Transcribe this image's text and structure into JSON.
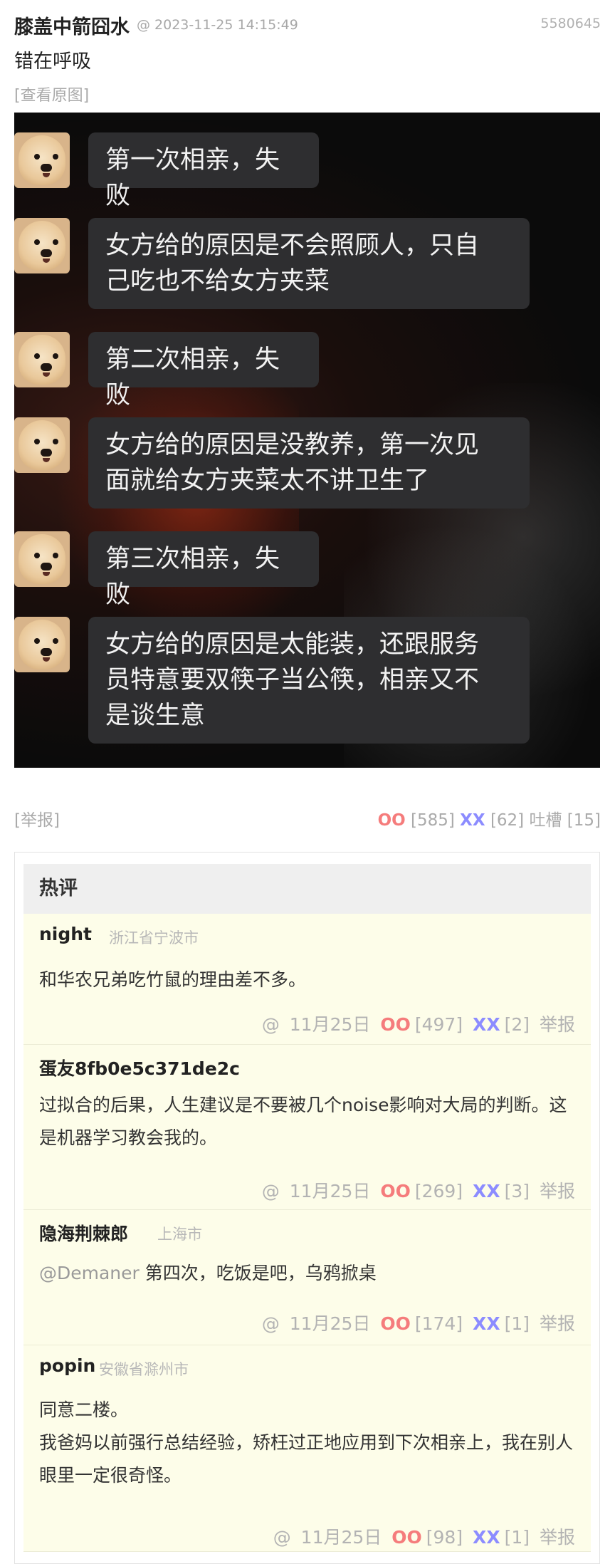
{
  "post": {
    "author": "膝盖中箭囧水",
    "time": "@ 2023-11-25 14:15:49",
    "id": "5580645",
    "text": "错在呼吸",
    "view_original": "[查看原图]"
  },
  "chat_image": {
    "messages": [
      "第一次相亲，失败",
      "女方给的原因是不会照顾人，只自\n己吃也不给女方夹菜",
      "第二次相亲，失败",
      "女方给的原因是没教养，第一次见\n面就给女方夹菜太不讲卫生了",
      "第三次相亲，失败",
      "女方给的原因是太能装，还跟服务\n员特意要双筷子当公筷，相亲又不\n是谈生意"
    ]
  },
  "post_footer": {
    "report": "[举报]",
    "oo_label": "OO",
    "oo_count": "[585]",
    "xx_label": "XX",
    "xx_count": "[62]",
    "tucao_label": "吐槽",
    "tucao_count": "[15]"
  },
  "hot_comments": {
    "title": "热评",
    "items": [
      {
        "name": "night",
        "location": "浙江省宁波市",
        "mention": "",
        "text": "和华农兄弟吃竹鼠的理由差不多。",
        "at": "@",
        "date": "11月25日",
        "oo_label": "OO",
        "oo": "[497]",
        "xx_label": "XX",
        "xx": "[2]",
        "report": "举报"
      },
      {
        "name": "蛋友8fb0e5c371de2c",
        "location": "",
        "mention": "",
        "text": "过拟合的后果，人生建议是不要被几个noise影响对大局的判断。这是机器学习教会我的。",
        "at": "@",
        "date": "11月25日",
        "oo_label": "OO",
        "oo": "[269]",
        "xx_label": "XX",
        "xx": "[3]",
        "report": "举报"
      },
      {
        "name": "隐海荆棘郎",
        "location": "上海市",
        "mention": "@Demaner",
        "text": " 第四次，吃饭是吧，乌鸦掀桌",
        "at": "@",
        "date": "11月25日",
        "oo_label": "OO",
        "oo": "[174]",
        "xx_label": "XX",
        "xx": "[1]",
        "report": "举报"
      },
      {
        "name": "popin",
        "location": "安徽省滁州市",
        "mention": "",
        "text": "同意二楼。\n我爸妈以前强行总结经验，矫枉过正地应用到下次相亲上，我在别人眼里一定很奇怪。",
        "at": "@",
        "date": "11月25日",
        "oo_label": "OO",
        "oo": "[98]",
        "xx_label": "XX",
        "xx": "[1]",
        "report": "举报"
      }
    ]
  }
}
